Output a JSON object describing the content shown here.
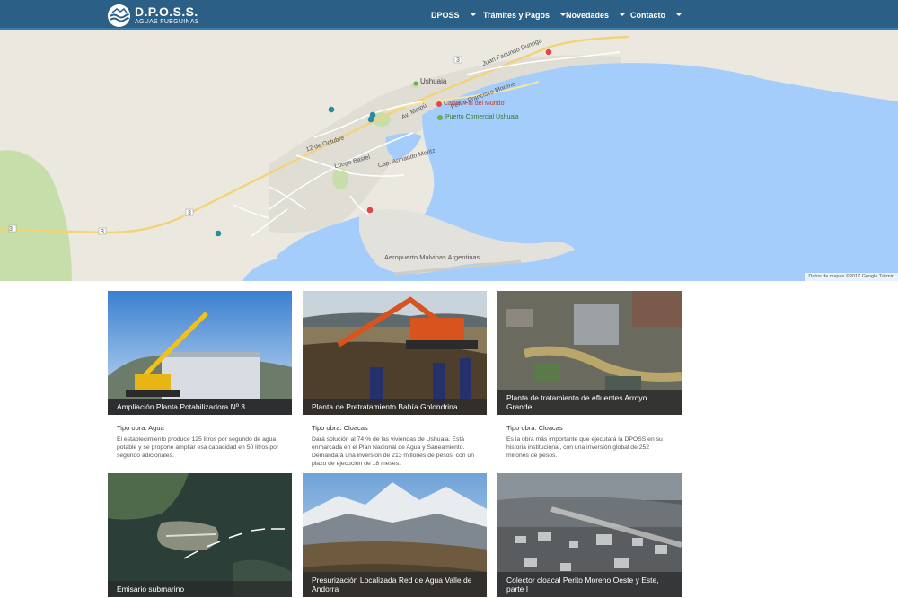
{
  "brand": {
    "title": "D.P.O.S.S.",
    "subtitle": "AGUAS FUEGUINAS"
  },
  "nav": [
    {
      "label": "DPOSS"
    },
    {
      "label": "Trámites y Pagos"
    },
    {
      "label": "Novedades"
    },
    {
      "label": "Contacto"
    }
  ],
  "map": {
    "labels": {
      "ushuaia": "Ushuaia",
      "cartel": "Cartel \"Fin del Mundo\"",
      "puerto": "Puerto Comercial Ushuaia",
      "airport": "Aeropuerto Malvinas Argentinas",
      "street_maipu": "Av. Maipú",
      "street_12oct": "12 de Octubre",
      "street_bastel": "Luego Bastel",
      "street_cap": "Cap. Armando Moritz",
      "street_perito": "Perito Francisco Moreno",
      "street_dunoga": "Juan Facundo Dunoga",
      "road_3": "3"
    },
    "attribution": "Datos de mapas ©2017 Google   Términ"
  },
  "colors": {
    "header": "#2b5f86",
    "water": "#a5cdfb",
    "land": "#ebe8df",
    "park": "#c6dfaa",
    "marker_blue": "#2a8aa0",
    "marker_red": "#e0474b",
    "caption_bg": "#333333"
  },
  "works": [
    {
      "title": "Ampliación Planta Potabilizadora Nº 3",
      "type": "Tipo obra: Agua",
      "description": "El establecimiento produce 125 litros por segundo de agua potable y se propone ampliar esa capacidad en 50 litros por segundo adicionales."
    },
    {
      "title": "Planta de Pretratamiento Bahía Golondrina",
      "type": "Tipo obra: Cloacas",
      "description": "Dará solución al 74 % de las viviendas de Ushuaia. Está enmarcada en el Plan Nacional de Agua y Saneamiento. Demandará una inversión de 213 millones de pesos, con un plazo de ejecución de 18 meses."
    },
    {
      "title": "Planta de tratamiento de efluentes Arroyo Grande",
      "type": "Tipo obra: Cloacas",
      "description": "Es la obra más importante que ejecutará la DPOSS en su historia institucional, con una inversión global de 252 millones de pesos."
    },
    {
      "title": "Emisario submarino"
    },
    {
      "title": "Presurización Localizada Red de Agua Valle de Andorra"
    },
    {
      "title": "Colector cloacal Perito Moreno Oeste y Este, parte I"
    }
  ]
}
